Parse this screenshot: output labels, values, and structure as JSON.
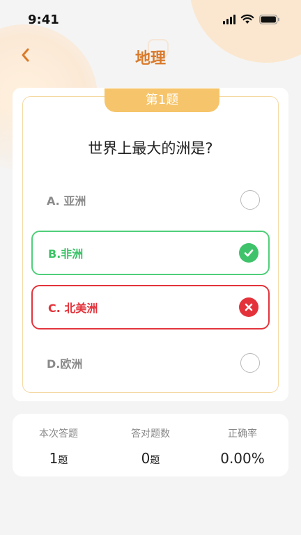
{
  "status_bar": {
    "time": "9:41",
    "signal_icon": "signal-icon",
    "wifi_icon": "wifi-icon",
    "battery_icon": "battery-icon"
  },
  "header": {
    "title": "地理",
    "back_icon": "chevron-left-icon"
  },
  "quiz": {
    "badge": "第1题",
    "question": "世界上最大的洲是?",
    "options": [
      {
        "label": "A. 亚洲",
        "state": "unselected"
      },
      {
        "label": "B.非洲",
        "state": "correct",
        "icon": "check-icon"
      },
      {
        "label": "C. 北美洲",
        "state": "wrong",
        "icon": "close-icon"
      },
      {
        "label": "D.欧洲",
        "state": "unselected"
      }
    ]
  },
  "stats": [
    {
      "label": "本次答题",
      "value": "1",
      "unit": "题"
    },
    {
      "label": "答对题数",
      "value": "0",
      "unit": "题"
    },
    {
      "label": "正确率",
      "value": "0.00%",
      "unit": ""
    }
  ],
  "colors": {
    "accent": "#d97a2b",
    "badge": "#f6c46a",
    "correct": "#3fc36a",
    "wrong": "#e4323b"
  }
}
